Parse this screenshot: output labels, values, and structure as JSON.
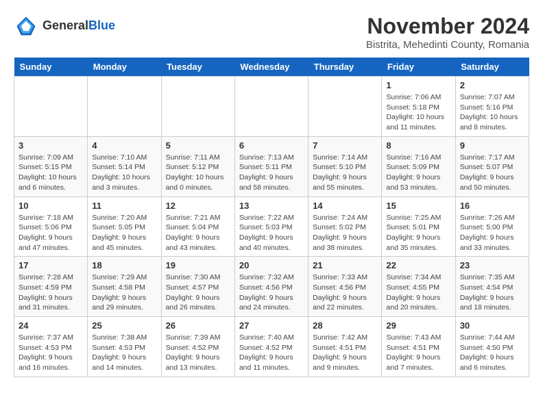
{
  "header": {
    "logo_general": "General",
    "logo_blue": "Blue",
    "month_title": "November 2024",
    "location": "Bistrita, Mehedinti County, Romania"
  },
  "days_of_week": [
    "Sunday",
    "Monday",
    "Tuesday",
    "Wednesday",
    "Thursday",
    "Friday",
    "Saturday"
  ],
  "weeks": [
    [
      {
        "day": "",
        "info": ""
      },
      {
        "day": "",
        "info": ""
      },
      {
        "day": "",
        "info": ""
      },
      {
        "day": "",
        "info": ""
      },
      {
        "day": "",
        "info": ""
      },
      {
        "day": "1",
        "info": "Sunrise: 7:06 AM\nSunset: 5:18 PM\nDaylight: 10 hours and 11 minutes."
      },
      {
        "day": "2",
        "info": "Sunrise: 7:07 AM\nSunset: 5:16 PM\nDaylight: 10 hours and 8 minutes."
      }
    ],
    [
      {
        "day": "3",
        "info": "Sunrise: 7:09 AM\nSunset: 5:15 PM\nDaylight: 10 hours and 6 minutes."
      },
      {
        "day": "4",
        "info": "Sunrise: 7:10 AM\nSunset: 5:14 PM\nDaylight: 10 hours and 3 minutes."
      },
      {
        "day": "5",
        "info": "Sunrise: 7:11 AM\nSunset: 5:12 PM\nDaylight: 10 hours and 0 minutes."
      },
      {
        "day": "6",
        "info": "Sunrise: 7:13 AM\nSunset: 5:11 PM\nDaylight: 9 hours and 58 minutes."
      },
      {
        "day": "7",
        "info": "Sunrise: 7:14 AM\nSunset: 5:10 PM\nDaylight: 9 hours and 55 minutes."
      },
      {
        "day": "8",
        "info": "Sunrise: 7:16 AM\nSunset: 5:09 PM\nDaylight: 9 hours and 53 minutes."
      },
      {
        "day": "9",
        "info": "Sunrise: 7:17 AM\nSunset: 5:07 PM\nDaylight: 9 hours and 50 minutes."
      }
    ],
    [
      {
        "day": "10",
        "info": "Sunrise: 7:18 AM\nSunset: 5:06 PM\nDaylight: 9 hours and 47 minutes."
      },
      {
        "day": "11",
        "info": "Sunrise: 7:20 AM\nSunset: 5:05 PM\nDaylight: 9 hours and 45 minutes."
      },
      {
        "day": "12",
        "info": "Sunrise: 7:21 AM\nSunset: 5:04 PM\nDaylight: 9 hours and 43 minutes."
      },
      {
        "day": "13",
        "info": "Sunrise: 7:22 AM\nSunset: 5:03 PM\nDaylight: 9 hours and 40 minutes."
      },
      {
        "day": "14",
        "info": "Sunrise: 7:24 AM\nSunset: 5:02 PM\nDaylight: 9 hours and 38 minutes."
      },
      {
        "day": "15",
        "info": "Sunrise: 7:25 AM\nSunset: 5:01 PM\nDaylight: 9 hours and 35 minutes."
      },
      {
        "day": "16",
        "info": "Sunrise: 7:26 AM\nSunset: 5:00 PM\nDaylight: 9 hours and 33 minutes."
      }
    ],
    [
      {
        "day": "17",
        "info": "Sunrise: 7:28 AM\nSunset: 4:59 PM\nDaylight: 9 hours and 31 minutes."
      },
      {
        "day": "18",
        "info": "Sunrise: 7:29 AM\nSunset: 4:58 PM\nDaylight: 9 hours and 29 minutes."
      },
      {
        "day": "19",
        "info": "Sunrise: 7:30 AM\nSunset: 4:57 PM\nDaylight: 9 hours and 26 minutes."
      },
      {
        "day": "20",
        "info": "Sunrise: 7:32 AM\nSunset: 4:56 PM\nDaylight: 9 hours and 24 minutes."
      },
      {
        "day": "21",
        "info": "Sunrise: 7:33 AM\nSunset: 4:56 PM\nDaylight: 9 hours and 22 minutes."
      },
      {
        "day": "22",
        "info": "Sunrise: 7:34 AM\nSunset: 4:55 PM\nDaylight: 9 hours and 20 minutes."
      },
      {
        "day": "23",
        "info": "Sunrise: 7:35 AM\nSunset: 4:54 PM\nDaylight: 9 hours and 18 minutes."
      }
    ],
    [
      {
        "day": "24",
        "info": "Sunrise: 7:37 AM\nSunset: 4:53 PM\nDaylight: 9 hours and 16 minutes."
      },
      {
        "day": "25",
        "info": "Sunrise: 7:38 AM\nSunset: 4:53 PM\nDaylight: 9 hours and 14 minutes."
      },
      {
        "day": "26",
        "info": "Sunrise: 7:39 AM\nSunset: 4:52 PM\nDaylight: 9 hours and 13 minutes."
      },
      {
        "day": "27",
        "info": "Sunrise: 7:40 AM\nSunset: 4:52 PM\nDaylight: 9 hours and 11 minutes."
      },
      {
        "day": "28",
        "info": "Sunrise: 7:42 AM\nSunset: 4:51 PM\nDaylight: 9 hours and 9 minutes."
      },
      {
        "day": "29",
        "info": "Sunrise: 7:43 AM\nSunset: 4:51 PM\nDaylight: 9 hours and 7 minutes."
      },
      {
        "day": "30",
        "info": "Sunrise: 7:44 AM\nSunset: 4:50 PM\nDaylight: 9 hours and 6 minutes."
      }
    ]
  ]
}
